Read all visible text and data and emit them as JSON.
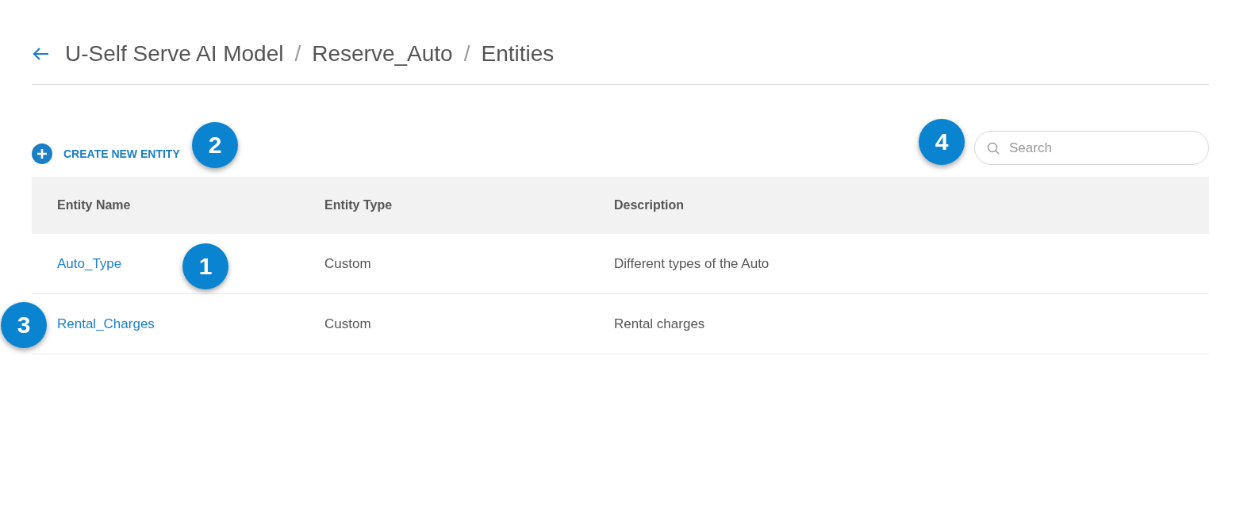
{
  "breadcrumb": {
    "items": [
      "U-Self Serve AI Model",
      "Reserve_Auto",
      "Entities"
    ],
    "separator": "/"
  },
  "create_button": {
    "label": "CREATE NEW ENTITY"
  },
  "search": {
    "placeholder": "Search"
  },
  "table": {
    "columns": [
      "Entity Name",
      "Entity Type",
      "Description"
    ],
    "rows": [
      {
        "cells": [
          "Auto_Type",
          "Custom",
          "Different types of the Auto"
        ]
      },
      {
        "cells": [
          "Rental_Charges",
          "Custom",
          "Rental charges"
        ]
      }
    ]
  },
  "callouts": [
    "1",
    "2",
    "3",
    "4"
  ]
}
